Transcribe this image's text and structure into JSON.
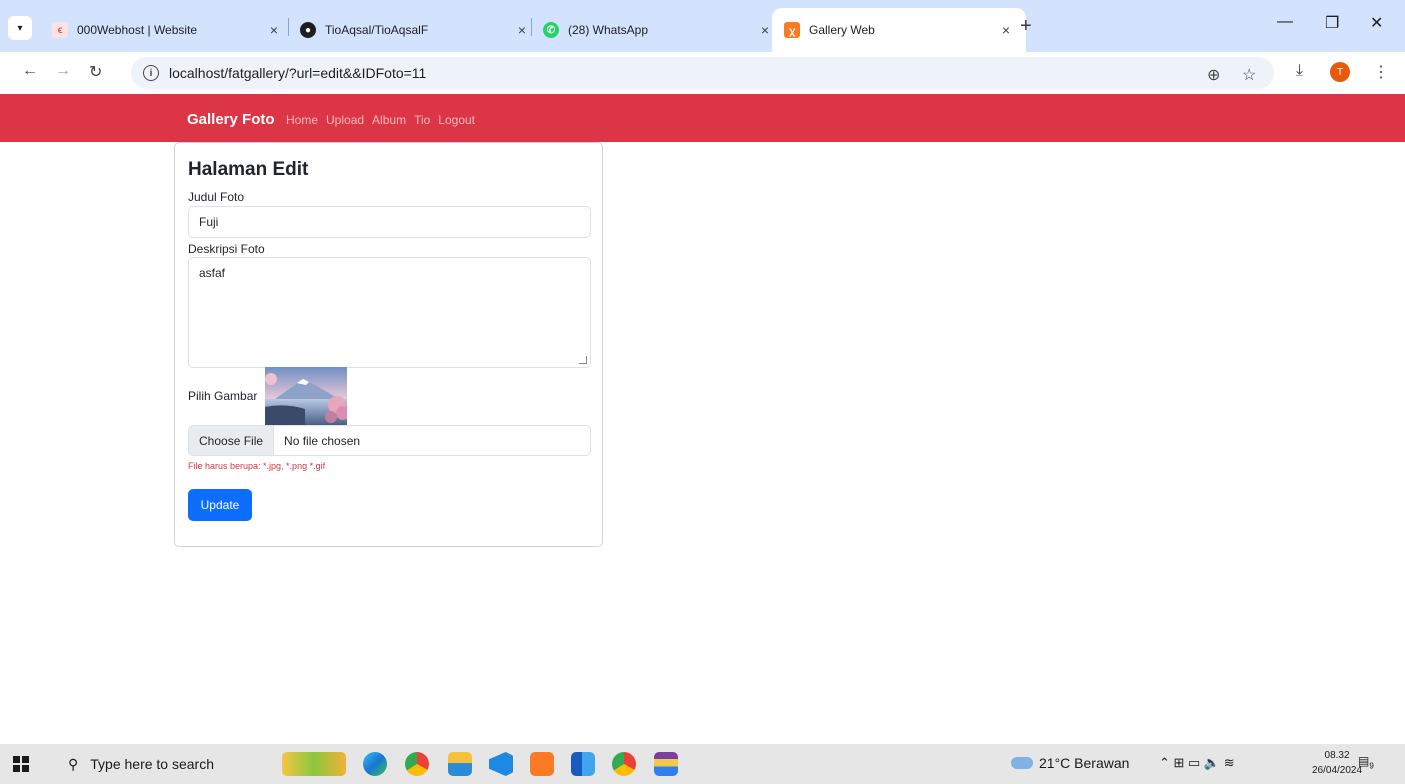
{
  "browser": {
    "tabs": [
      {
        "title": "000Webhost | Website",
        "icon": "webhost-favicon-icon",
        "active": false
      },
      {
        "title": "TioAqsal/TioAqsalF",
        "icon": "github-favicon-icon",
        "active": false
      },
      {
        "title": "(28) WhatsApp",
        "icon": "whatsapp-favicon-icon",
        "active": false
      },
      {
        "title": "Gallery Web",
        "icon": "xampp-favicon-icon",
        "active": true
      }
    ],
    "url": "localhost/fatgallery/?url=edit&&IDFoto=11",
    "profile_initial": "T"
  },
  "navbar": {
    "brand": "Gallery Foto",
    "links": [
      "Home",
      "Upload",
      "Album",
      "Tio",
      "Logout"
    ]
  },
  "form": {
    "title": "Halaman Edit",
    "judul_label": "Judul Foto",
    "judul_value": "Fuji",
    "deskripsi_label": "Deskripsi Foto",
    "deskripsi_value": "asfaf",
    "gambar_label": "Pilih Gambar",
    "file_button": "Choose File",
    "file_status": "No file chosen",
    "hint": "File harus berupa: *.jpg, *.png *.gif",
    "submit_label": "Update"
  },
  "taskbar": {
    "search_placeholder": "Type here to search",
    "weather": "21°C  Berawan",
    "time": "08.32",
    "date": "26/04/2024",
    "notification_count": "9"
  },
  "colors": {
    "navbar_bg": "#dc3545",
    "primary": "#0d6efd",
    "tabstrip_bg": "#d3e3fd"
  }
}
